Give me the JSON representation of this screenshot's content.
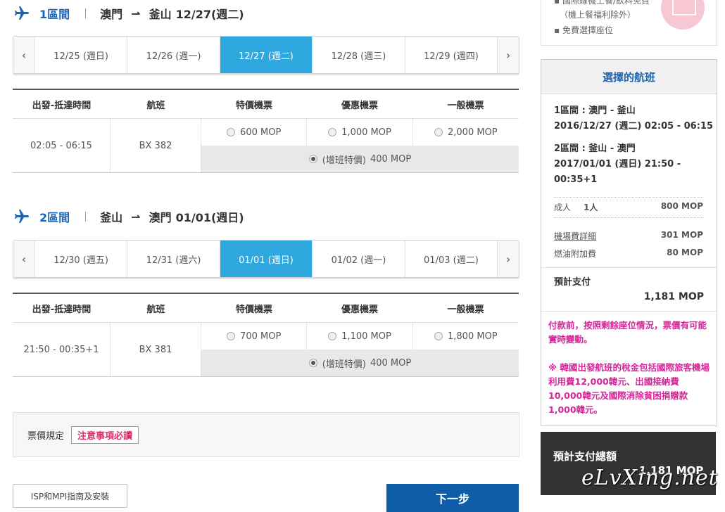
{
  "segment1": {
    "label": "1區間",
    "from": "澳門",
    "arrow": "⇀",
    "to": "釜山",
    "date": "12/27(週二)",
    "dates": [
      "12/25 (週日)",
      "12/26 (週一)",
      "12/27 (週二)",
      "12/28 (週三)",
      "12/29 (週四)"
    ],
    "selected_index": 2,
    "headers": [
      "出發-抵達時間",
      "航班",
      "特價機票",
      "優惠機票",
      "一般機票"
    ],
    "time": "02:05 - 06:15",
    "flight": "BX 382",
    "prices": [
      "600 MOP",
      "1,000 MOP",
      "2,000 MOP"
    ],
    "special_label": "(增班特價)",
    "special_price": "400 MOP"
  },
  "segment2": {
    "label": "2區間",
    "from": "釜山",
    "arrow": "⇀",
    "to": "澳門",
    "date": "01/01(週日)",
    "dates": [
      "12/30 (週五)",
      "12/31 (週六)",
      "01/01 (週日)",
      "01/02 (週一)",
      "01/03 (週二)"
    ],
    "selected_index": 2,
    "headers": [
      "出發-抵達時間",
      "航班",
      "特價機票",
      "優惠機票",
      "一般機票"
    ],
    "time": "21:50 - 00:35+1",
    "flight": "BX 381",
    "prices": [
      "700 MOP",
      "1,100 MOP",
      "1,800 MOP"
    ],
    "special_label": "(增班特價)",
    "special_price": "400 MOP"
  },
  "nav": {
    "prev": "‹",
    "next": "›"
  },
  "rules": {
    "label": "票價規定",
    "button": "注意事項必讀"
  },
  "buttons": {
    "isp": "ISP和MPI指南及安裝",
    "next": "下一步"
  },
  "benefits": {
    "line1": "國際線機上餐/飲料免費",
    "line2": "（機上餐福利除外）",
    "line3": "免費選擇座位"
  },
  "summary": {
    "title": "選擇的航班",
    "seg1_route": "1區間 : 澳門 - 釜山",
    "seg1_time": "2016/12/27 (週二) 02:05 - 06:15",
    "seg2_route": "2區間 : 釜山 - 澳門",
    "seg2_time_a": "2017/01/01 (週日) 21:50 -",
    "seg2_time_b": "00:35+1",
    "adult_label": "成人",
    "adult_count": "1人",
    "adult_price": "800 MOP",
    "airport_fee_label": "機場費詳細",
    "airport_fee": "301 MOP",
    "fuel_label": "燃油附加費",
    "fuel_fee": "80 MOP",
    "est_label": "預計支付",
    "est_total": "1,181 MOP",
    "warn1": "付款前，按照剩餘座位情況，票價有可能實時變動。",
    "warn2": "※ 韓國出發航班的稅金包括國際旅客機場利用費12,000韓元、出國接納費10,000韓元及國際消除貧困捐贈款1,000韓元。"
  },
  "total": {
    "label": "預計支付總額",
    "value": "1,181 MOP"
  },
  "watermark": "eLvXing.net",
  "colors": {
    "accent": "#2fa8e0",
    "brand": "#1a64b4",
    "warn": "#d6269a"
  }
}
